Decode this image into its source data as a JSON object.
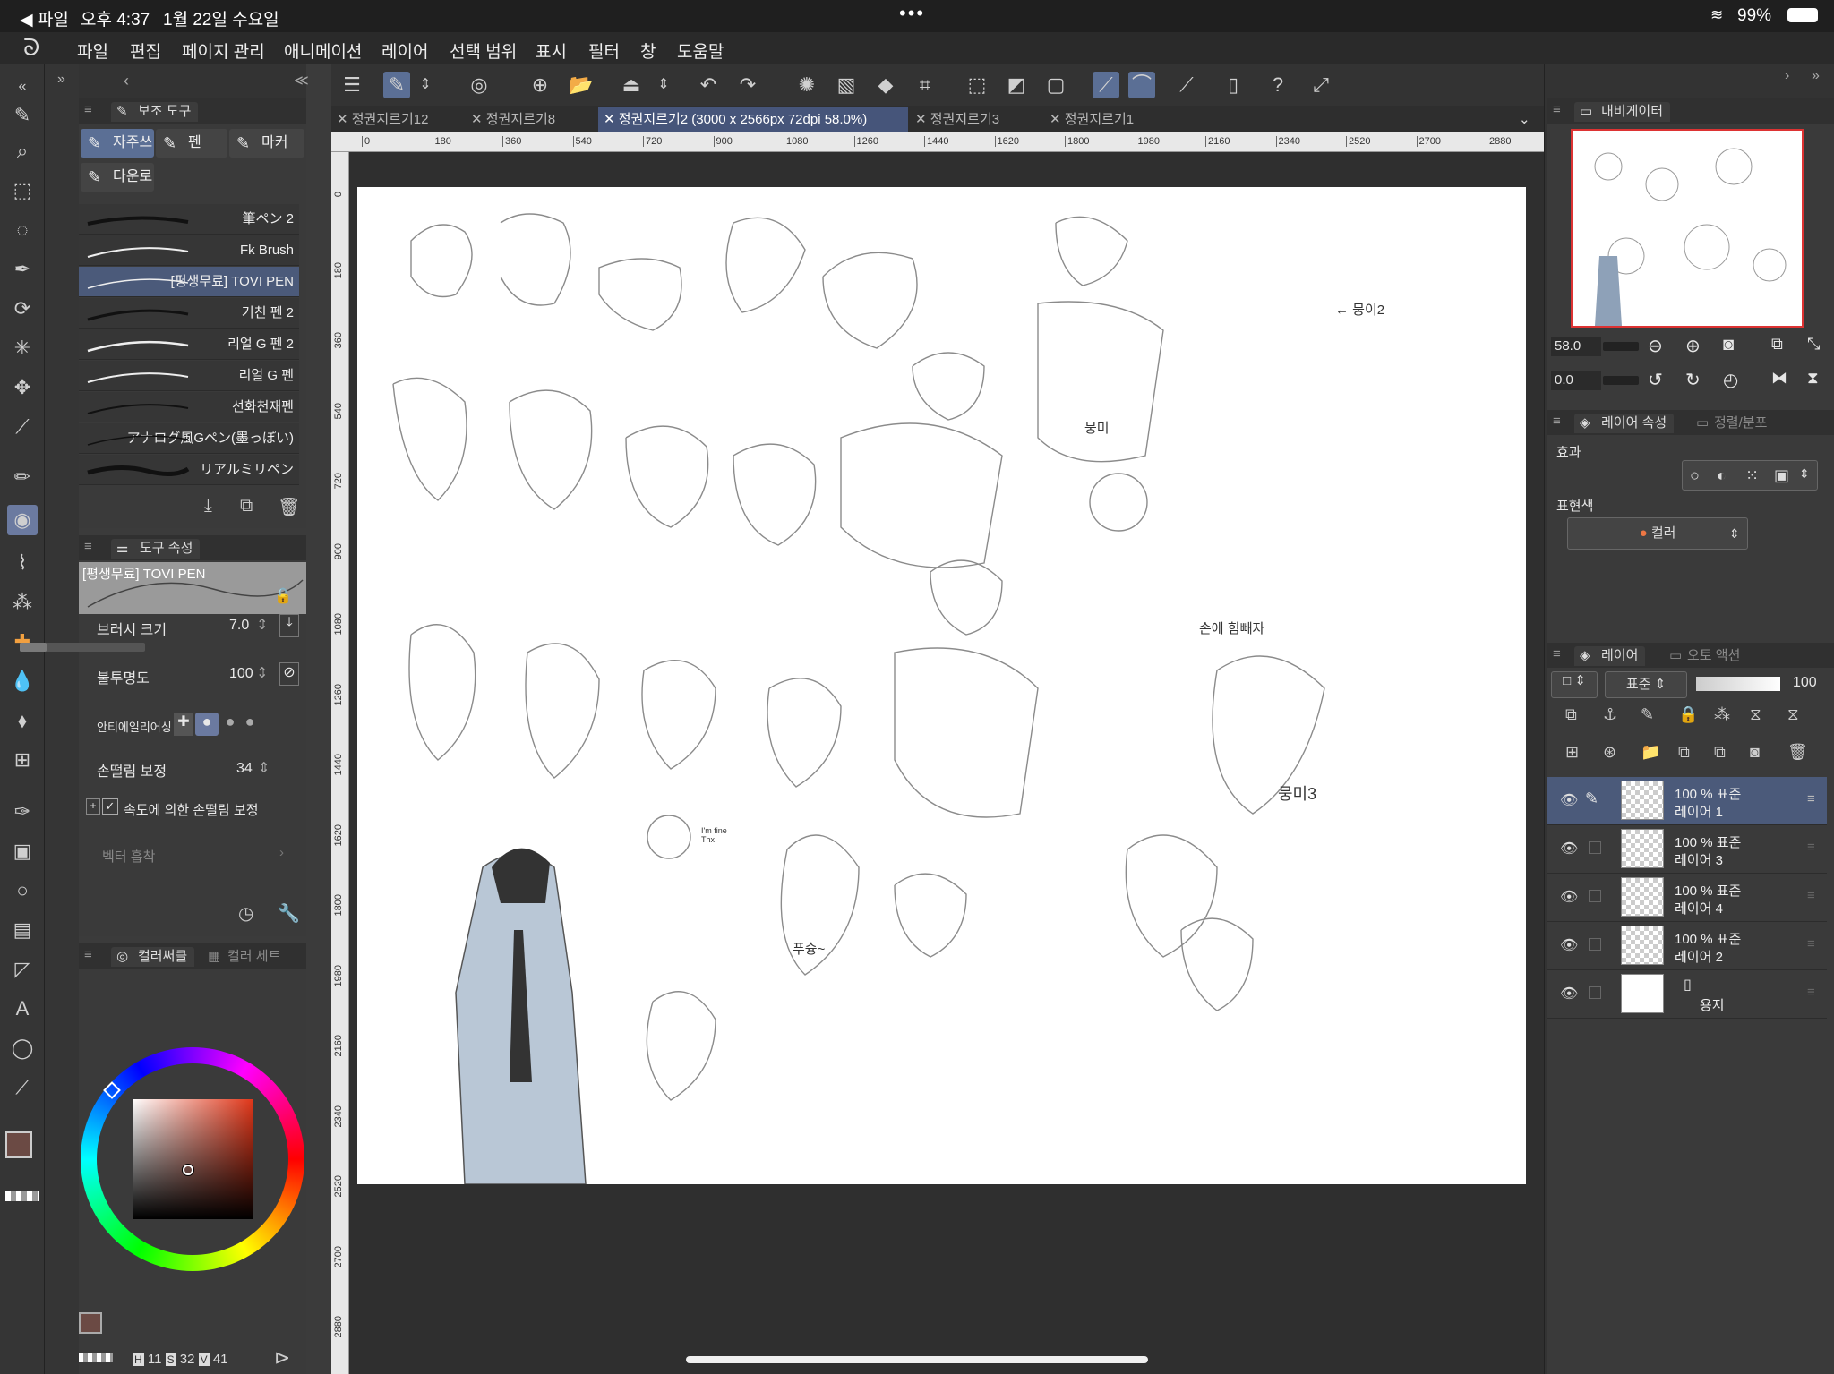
{
  "status": {
    "back_app": "◀ 파일",
    "time": "오후 4:37",
    "date": "1월 22일 수요일",
    "wifi": "",
    "battery": "99%"
  },
  "menu": [
    "파일",
    "편집",
    "페이지 관리",
    "애니메이션",
    "레이어",
    "선택 범위",
    "표시",
    "필터",
    "창",
    "도움말"
  ],
  "subtool": {
    "title": "보조 도구",
    "groups": [
      "자주쓰",
      "펜",
      "마커",
      "다운로"
    ],
    "brushes": [
      "筆ペン 2",
      "Fk Brush",
      "[평생무료] TOVI PEN",
      "거친 펜 2",
      "리얼 G 펜 2",
      "리얼 G 펜",
      "선화천재펜",
      "アナログ風Gペン(墨っぽい)",
      "リアルミリペン"
    ]
  },
  "toolprop": {
    "title": "도구 속성",
    "brush_name": "[평생무료] TOVI PEN",
    "brush_size_label": "브러시 크기",
    "brush_size_value": "7.0",
    "opacity_label": "불투명도",
    "opacity_value": "100",
    "antialias_label": "안티에일리어싱",
    "stabilization_label": "손떨림 보정",
    "stabilization_value": "34",
    "speed_stab_label": "속도에 의한 손떨림 보정",
    "vector_label": "벡터 흡착"
  },
  "colorpanel": {
    "tab1": "컬러써클",
    "tab2": "컬러 세트",
    "hsv": {
      "h_label": "H",
      "h": "11",
      "s_label": "S",
      "s": "32",
      "v_label": "V",
      "v": "41"
    },
    "main_color": "#6b4a44",
    "sub_color": "#d8c89a"
  },
  "doc_tabs": [
    "정권지르기12",
    "정권지르기8",
    "정권지르기2 (3000 x 2566px 72dpi 58.0%)",
    "정권지르기3",
    "정권지르기1"
  ],
  "ruler_h": [
    "0",
    "180",
    "360",
    "540",
    "720",
    "900",
    "1080",
    "1260",
    "1440",
    "1620",
    "1800",
    "1980",
    "2160",
    "2340",
    "2520",
    "2700",
    "2880"
  ],
  "ruler_v": [
    "0",
    "180",
    "360",
    "540",
    "720",
    "900",
    "1080",
    "1260",
    "1440",
    "1620",
    "1800",
    "1980",
    "2160",
    "2340",
    "2520",
    "2700",
    "2880"
  ],
  "canvas_labels": {
    "a": "← 뭉이2",
    "b": "뭉미",
    "c": "뭉미3",
    "d": "손에 힘빼자",
    "e": "I'm fine Thx",
    "f": "푸슝~"
  },
  "navigator": {
    "title": "내비게이터",
    "zoom": "58.0",
    "angle": "0.0"
  },
  "layerprop": {
    "title": "레이어 속성",
    "tab2": "정렬/분포",
    "effect_label": "효과",
    "expr_label": "표현색",
    "expr_value": "컬러"
  },
  "layers": {
    "title": "레이어",
    "tab2": "오토 액션",
    "blend": "표준",
    "opacity": "100",
    "rows": [
      {
        "line1": "100 %  표준",
        "line2": "레이어 1"
      },
      {
        "line1": "100 %  표준",
        "line2": "레이어 3"
      },
      {
        "line1": "100 %  표준",
        "line2": "레이어 4"
      },
      {
        "line1": "100 %  표준",
        "line2": "레이어 2"
      },
      {
        "line1": "",
        "line2": "용지"
      }
    ]
  }
}
